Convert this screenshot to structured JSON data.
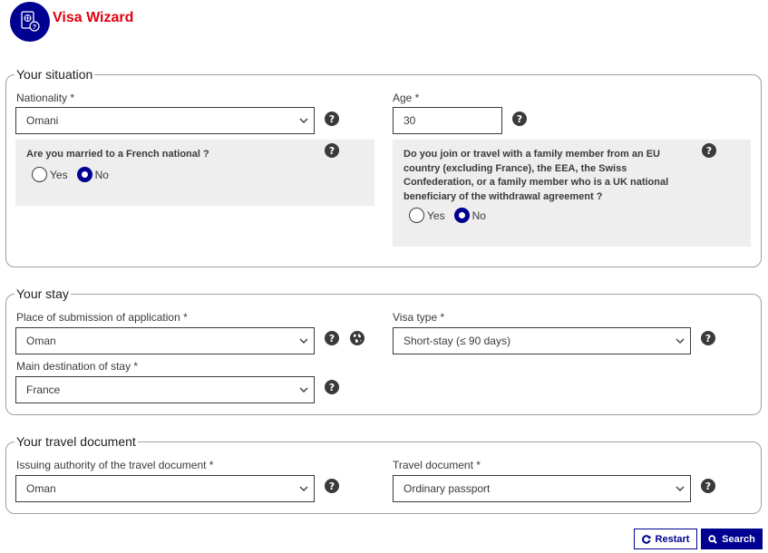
{
  "header": {
    "title": "Visa Wizard",
    "logo_icon": "passport-question-icon"
  },
  "situation": {
    "legend": "Your situation",
    "nationality": {
      "label": "Nationality *",
      "value": "Omani"
    },
    "age": {
      "label": "Age *",
      "value": "30"
    },
    "married_question": {
      "text": "Are you married to a French national ?",
      "options": [
        "Yes",
        "No"
      ],
      "selected": "No"
    },
    "family_question": {
      "text": "Do you join or travel with a family member from an EU country (excluding France), the EEA, the Swiss Confederation, or a family member who is a UK national beneficiary of the withdrawal agreement ?",
      "options": [
        "Yes",
        "No"
      ],
      "selected": "No"
    }
  },
  "stay": {
    "legend": "Your stay",
    "place_submission": {
      "label": "Place of submission of application *",
      "value": "Oman"
    },
    "visa_type": {
      "label": "Visa type *",
      "value": "Short-stay (≤ 90 days)"
    },
    "main_destination": {
      "label": "Main destination of stay *",
      "value": "France"
    }
  },
  "travel_document": {
    "legend": "Your travel document",
    "issuing_authority": {
      "label": "Issuing authority of the travel document *",
      "value": "Oman"
    },
    "document": {
      "label": "Travel document *",
      "value": "Ordinary passport"
    }
  },
  "actions": {
    "restart_label": "Restart",
    "search_label": "Search"
  },
  "colors": {
    "brand_blue": "#000091",
    "title_red": "#e1000f",
    "grey_box": "#eeeeee"
  }
}
